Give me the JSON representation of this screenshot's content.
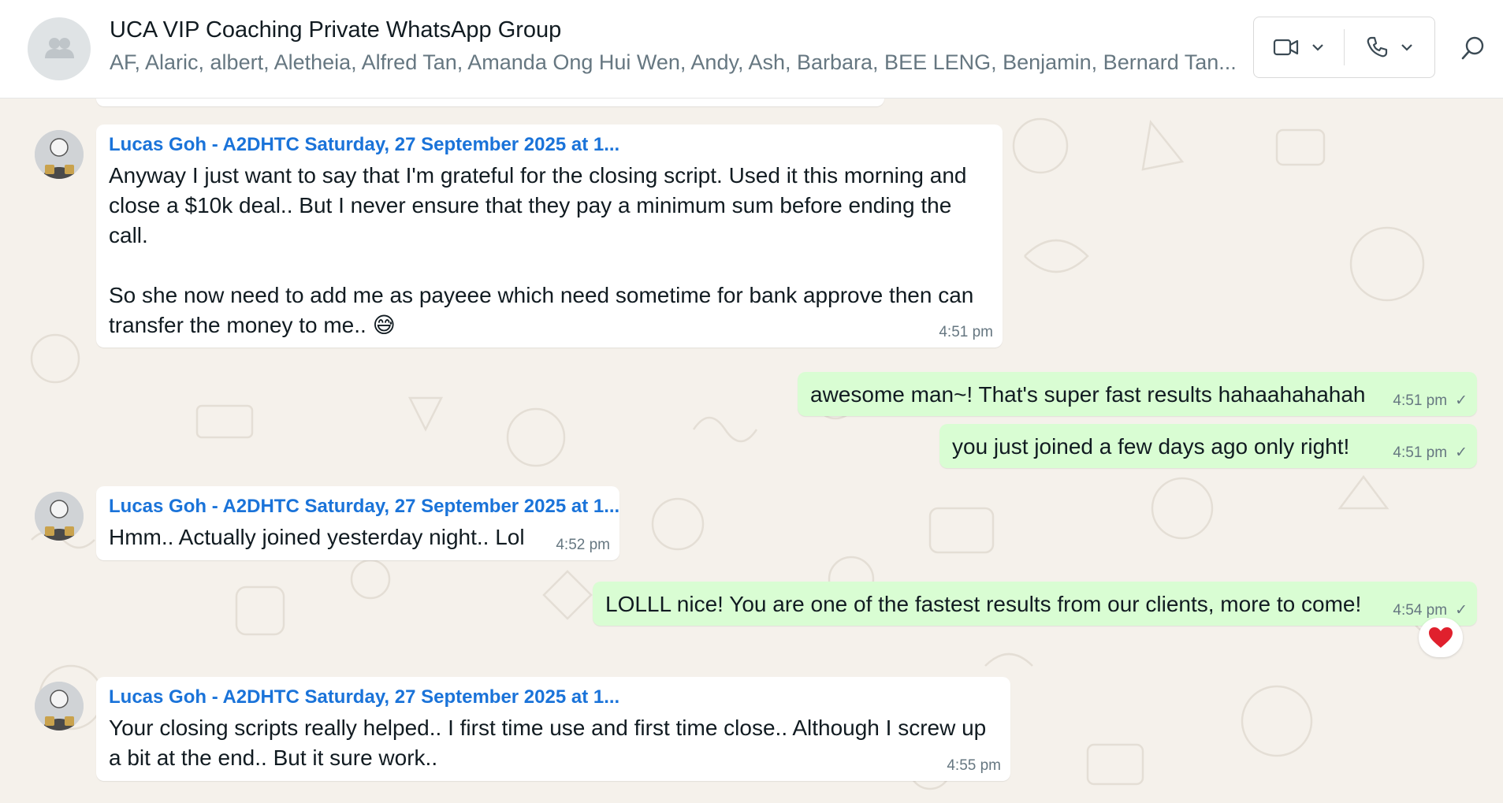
{
  "header": {
    "title": "UCA VIP Coaching Private WhatsApp Group",
    "members": "AF, Alaric, albert, Aletheia, Alfred Tan, Amanda Ong Hui Wen, Andy, Ash, Barbara, BEE LENG, Benjamin, Bernard Tan...",
    "video_icon": "video-camera-icon",
    "call_icon": "phone-icon",
    "search_icon": "search-icon"
  },
  "messages": [
    {
      "direction": "in",
      "sender": "Lucas Goh - A2DHTC Saturday, 27 September 2025 at 1...",
      "text": "Anyway I just want to say that I'm grateful for the closing script. Used it this morning and close a $10k deal.. But I never ensure that they pay a minimum sum before ending the call.\n\nSo she now need to add me as payeee which need sometime for bank approve then can transfer the money to me.. 😅",
      "time": "4:51 pm"
    },
    {
      "direction": "out",
      "text": "awesome man~! That's super fast results hahaahahahah",
      "time": "4:51 pm",
      "status": "✓"
    },
    {
      "direction": "out",
      "text": "you just joined a few days ago only right!",
      "time": "4:51 pm",
      "status": "✓"
    },
    {
      "direction": "in",
      "sender": "Lucas Goh - A2DHTC Saturday, 27 September 2025 at 1...",
      "text": "Hmm.. Actually joined yesterday night.. Lol",
      "time": "4:52 pm"
    },
    {
      "direction": "out",
      "text": "LOLLL nice! You are one of the fastest results from our clients, more to come!",
      "time": "4:54 pm",
      "status": "✓",
      "reaction": "❤️"
    },
    {
      "direction": "in",
      "sender": "Lucas Goh - A2DHTC Saturday, 27 September 2025 at 1...",
      "text": "Your closing scripts really helped.. I first time use and first time close.. Although I screw up a bit at the end.. But it sure work..",
      "time": "4:55 pm"
    }
  ],
  "colors": {
    "outgoing_bubble": "#d9fdd3",
    "incoming_bubble": "#ffffff",
    "sender_name": "#1a73d9",
    "wallpaper": "#f5f1eb"
  }
}
